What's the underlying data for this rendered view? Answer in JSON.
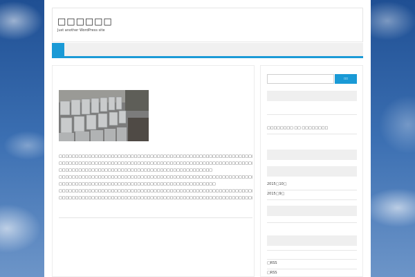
{
  "site": {
    "title": "□□□□□□",
    "tagline": "Just another WordPress site"
  },
  "post": {
    "image_alt": "concrete blocks photo",
    "lines": [
      "□□□□□□□□□□□□□□□□□□□□□□□□□□□□□□□□□□□□□□□□□□□□□□□□□□□□□□□□□□□□□□□□□□□□□□",
      "□□□□□□□□□□□□□□□□□□□□□□□□□□□□□□□□□□□□□□□□□□□□□□□□□□□□□□□□□□□□□□□□□□□□□□□",
      "□□□□□□□□□□□□□□□□□□□□□□□□□□□□□□□□□□□□□□□□□□□□□□□",
      "□□□□□□□□□□□□□□□□□□□□□□□□□□□□□□□□□□□□□□□□□□□□□□□□□□□□□□□□□□□□□□□□□□□□□□□□□",
      "□□□□□□□□□□□□□□□□□□□□□□□□□□□□□□□□□□□□□□□□□□□□□□□□",
      "□□□□□□□□□□□□□□□□□□□□□□□□□□□□□□□□□□□□□□□□□□□□□□□□□□□□□□□□□□□□",
      "□□□□□□□□□□□□□□□□□□□□□□□□□□□□□□□□□□□□□□□□□□□□□□□□□□□□□□□□□□□□□□□□□□□□□□□□□□□□□□□□□□□□□□□□□□□□"
    ]
  },
  "sidebar": {
    "search_button": "□□",
    "recent_link": "□□□□□□□□ □□ □□□□□□□□",
    "archives": [
      "2015□10□",
      "2015□9□"
    ],
    "meta": [
      "□RSS",
      "□RSS"
    ]
  },
  "colors": {
    "accent": "#1a9ad6",
    "nav_background": "#f0f0f0",
    "widget_title_background": "#efefef"
  }
}
